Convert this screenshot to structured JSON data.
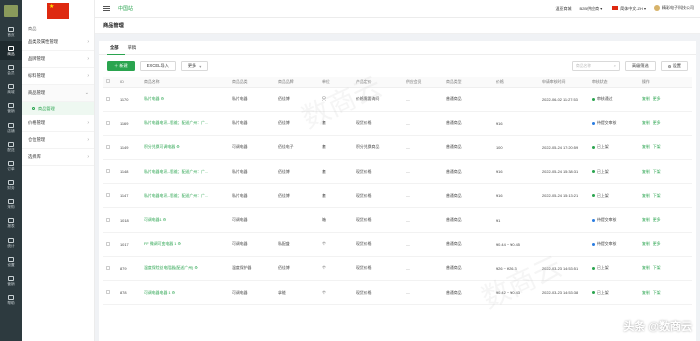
{
  "rail": {
    "items": [
      {
        "label": "首页",
        "active": false
      },
      {
        "label": "商品",
        "active": true
      },
      {
        "label": "会员",
        "active": false
      },
      {
        "label": "商城",
        "active": false
      },
      {
        "label": "营销",
        "active": false
      },
      {
        "label": "店铺",
        "active": false
      },
      {
        "label": "配送",
        "active": false
      },
      {
        "label": "订单",
        "active": false
      },
      {
        "label": "财务",
        "active": false
      },
      {
        "label": "采购",
        "active": false
      },
      {
        "label": "报表",
        "active": false
      },
      {
        "label": "统计",
        "active": false
      },
      {
        "label": "设置",
        "active": false
      },
      {
        "label": "营销",
        "active": false
      },
      {
        "label": "帮助",
        "active": false
      }
    ]
  },
  "menu": {
    "section": "商品",
    "items": [
      {
        "label": "品类及属性管理"
      },
      {
        "label": "品牌管理"
      },
      {
        "label": "标料管理"
      },
      {
        "label": "商品管理",
        "open": true
      }
    ],
    "sub_item": "商品管理",
    "items_after": [
      {
        "label": "价格管理"
      },
      {
        "label": "仓位管理"
      },
      {
        "label": "选择库"
      }
    ]
  },
  "topbar": {
    "site": "中国站",
    "mall": "温亚商城",
    "supply": "B2B供应商",
    "language": "简体中文-ZH",
    "account": "精彩电子科技公司"
  },
  "page": {
    "title": "商品管理"
  },
  "tabs": [
    "全部",
    "草稿"
  ],
  "toolbar": {
    "new_label": "新建",
    "excel_label": "EXCEL导入",
    "more_label": "更多",
    "search_placeholder": "商品名称",
    "advanced_label": "高级筛选",
    "settings_label": "设置"
  },
  "table": {
    "headers": [
      "",
      "ID",
      "商品名称",
      "商品品类",
      "商品品牌",
      "单位",
      "产品定价",
      "供应会员",
      "商品类型",
      "价格",
      "申请审核时间",
      "审核状态",
      "操作"
    ],
    "rows": [
      {
        "id": "1170",
        "name": "私片电器 ⚙",
        "category": "私片电器",
        "brand": "佰佳博",
        "unit": "只",
        "pricing": "价格需要询问",
        "member": "—",
        "type": "普通商品",
        "price": "",
        "time": "2022-06-02 11:27:53",
        "status": "审核通过",
        "status_color": "#2aa44f",
        "ops": [
          "复制",
          "更多"
        ]
      },
      {
        "id": "1169",
        "name": "私片电器电讯--思维；配送广州：广...",
        "category": "私片电器",
        "brand": "佰佳博",
        "unit": "套",
        "pricing": "现货价格",
        "member": "—",
        "type": "普通商品",
        "price": "¥16",
        "time": "",
        "status": "待提交审核",
        "status_color": "#2a7de1",
        "ops": [
          "复制",
          "更多"
        ]
      },
      {
        "id": "1149",
        "name": "积分兑换可调电器 ⚙",
        "category": "可调电器",
        "brand": "佰佳电子",
        "unit": "套",
        "pricing": "积分兑换商品",
        "member": "—",
        "type": "普通商品",
        "price": "100",
        "time": "2022-05-24 17:20:59",
        "status": "已上架",
        "status_color": "#2aa44f",
        "ops": [
          "复制",
          "下架"
        ]
      },
      {
        "id": "1148",
        "name": "私片电器电讯--思维；配送广州：广...",
        "category": "私片电器",
        "brand": "佰佳博",
        "unit": "套",
        "pricing": "现货价格",
        "member": "—",
        "type": "普通商品",
        "price": "¥16",
        "time": "2022-05-24 15:38:31",
        "status": "已上架",
        "status_color": "#2aa44f",
        "ops": [
          "复制",
          "下架"
        ]
      },
      {
        "id": "1147",
        "name": "私片电器电讯--思维；配送广州：广...",
        "category": "私片电器",
        "brand": "佰佳博",
        "unit": "套",
        "pricing": "现货价格",
        "member": "—",
        "type": "普通商品",
        "price": "¥16",
        "time": "2022-05-24 15:13:21",
        "status": "已上架",
        "status_color": "#2aa44f",
        "ops": [
          "复制",
          "下架"
        ]
      },
      {
        "id": "1018",
        "name": "可调电器1 ⚙",
        "category": "可调电器",
        "brand": "",
        "unit": "箱",
        "pricing": "现货价格",
        "member": "—",
        "type": "普通商品",
        "price": "¥1",
        "time": "",
        "status": "待提交审核",
        "status_color": "#2a7de1",
        "ops": [
          "复制",
          "更多"
        ]
      },
      {
        "id": "1017",
        "name": "FF 微调可变电器 1 ⚙",
        "category": "可调电器",
        "brand": "私配盛",
        "unit": "个",
        "pricing": "现货价格",
        "member": "—",
        "type": "普通商品",
        "price": "¥0.44 ~ ¥0.45",
        "time": "",
        "status": "待提交审核",
        "status_color": "#2a7de1",
        "ops": [
          "复制",
          "更多"
        ]
      },
      {
        "id": "879",
        "name": "温度保险丝电阻器(配送广州) ⚙",
        "category": "温度保护器",
        "brand": "佰佳博",
        "unit": "个",
        "pricing": "现货价格",
        "member": "—",
        "type": "普通商品",
        "price": "¥26 ~ ¥26.3",
        "time": "2022-03-23 14:53:51",
        "status": "已上架",
        "status_color": "#2aa44f",
        "ops": [
          "复制",
          "下架"
        ]
      },
      {
        "id": "878",
        "name": "可调电器电器 1 ⚙",
        "category": "可调电器",
        "brand": "拿能",
        "unit": "个",
        "pricing": "现货价格",
        "member": "—",
        "type": "普通商品",
        "price": "¥0.42 ~ ¥0.43",
        "time": "2022-03-23 14:53:38",
        "status": "已上架",
        "status_color": "#2aa44f",
        "ops": [
          "复制",
          "下架"
        ]
      }
    ]
  },
  "watermark": {
    "text": "头条 @数商云",
    "bg_text": "数商云"
  }
}
